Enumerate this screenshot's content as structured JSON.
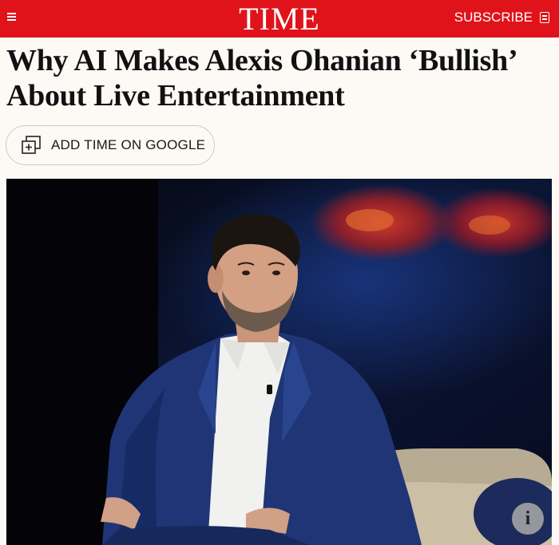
{
  "header": {
    "logo": "TIME",
    "subscribe_label": "SUBSCRIBE",
    "menu_icon": "hamburger-menu-icon",
    "subscribe_icon": "magazine-icon",
    "bar_color": "#e0131b"
  },
  "article": {
    "headline": "Why AI Makes Alexis Ohanian ‘Bullish’ About Live Entertainment",
    "google_button_label": "ADD TIME ON GOOGLE",
    "google_button_icon": "add-source-icon"
  },
  "photo": {
    "info_label": "i",
    "info_icon": "info-icon"
  }
}
